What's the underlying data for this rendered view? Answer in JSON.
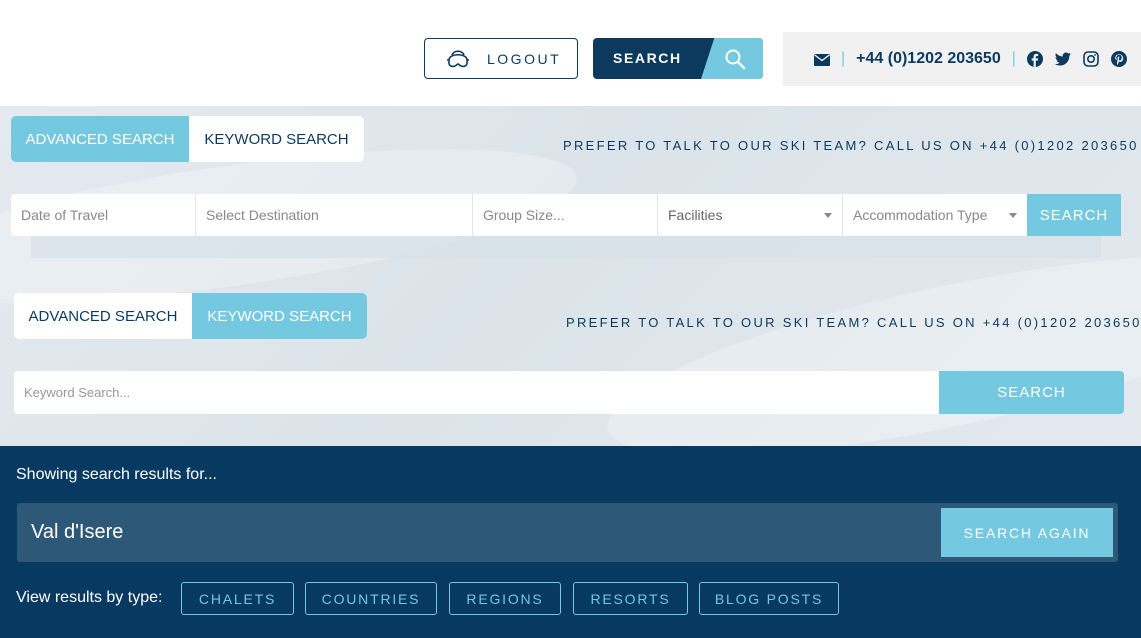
{
  "header": {
    "logout_label": "LOGOUT",
    "search_label": "SEARCH",
    "phone": "+44 (0)1202 203650",
    "separator": "|"
  },
  "advanced_section": {
    "tabs": [
      {
        "label": "ADVANCED SEARCH",
        "active": true
      },
      {
        "label": "KEYWORD SEARCH",
        "active": false
      }
    ],
    "talk_text": "PREFER TO TALK TO OUR SKI TEAM? CALL US ON +44 (0)1202 203650",
    "fields": {
      "date_placeholder": "Date of Travel",
      "destination_placeholder": "Select Destination",
      "group_placeholder": "Group Size...",
      "facilities_label": "Facilities",
      "accommodation_label": "Accommodation Type"
    },
    "search_label": "SEARCH"
  },
  "keyword_section": {
    "tabs": [
      {
        "label": "ADVANCED SEARCH",
        "active": false
      },
      {
        "label": "KEYWORD SEARCH",
        "active": true
      }
    ],
    "talk_text": "PREFER TO TALK TO OUR SKI TEAM? CALL US ON +44 (0)1202 203650",
    "keyword_placeholder": "Keyword Search...",
    "search_label": "SEARCH"
  },
  "results": {
    "showing_text": "Showing search results for...",
    "query_value": "Val d'Isere",
    "search_again_label": "SEARCH AGAIN",
    "view_by_label": "View results by type:",
    "types": [
      "CHALETS",
      "COUNTRIES",
      "REGIONS",
      "RESORTS",
      "BLOG POSTS"
    ]
  },
  "icons": {
    "logout": "ski-goggles-icon",
    "search": "magnifier-icon",
    "mail": "envelope-icon",
    "social": [
      "facebook-icon",
      "twitter-icon",
      "instagram-icon",
      "pinterest-icon"
    ]
  },
  "colors": {
    "navy": "#0b3a5e",
    "accent": "#74c8e0",
    "results_bg": "#073961",
    "query_bg": "#2d5878"
  }
}
